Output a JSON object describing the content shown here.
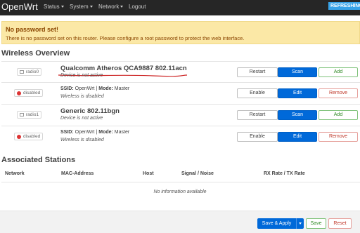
{
  "navbar": {
    "brand": "OpenWrt",
    "menu": [
      {
        "label": "Status",
        "dropdown": true
      },
      {
        "label": "System",
        "dropdown": true
      },
      {
        "label": "Network",
        "dropdown": true
      },
      {
        "label": "Logout",
        "dropdown": false
      }
    ],
    "refresh_badge": "REFRESHING"
  },
  "alert": {
    "title": "No password set!",
    "text": "There is no password set on this router. Please configure a root password to protect the web interface."
  },
  "wireless": {
    "title": "Wireless Overview",
    "rows": [
      {
        "badge": "radio0",
        "title": "Qualcomm Atheros QCA9887 802.11acn",
        "subtitle": "Device is not active",
        "buttons": [
          "Restart",
          "Scan",
          "Add"
        ]
      },
      {
        "badge": "disabled",
        "ssid_label": "SSID:",
        "ssid_value": "OpenWrt",
        "mode_label": "Mode:",
        "mode_value": "Master",
        "subtitle": "Wireless is disabled",
        "buttons": [
          "Enable",
          "Edit",
          "Remove"
        ]
      },
      {
        "badge": "radio1",
        "title": "Generic 802.11bgn",
        "subtitle": "Device is not active",
        "buttons": [
          "Restart",
          "Scan",
          "Add"
        ]
      },
      {
        "badge": "disabled",
        "ssid_label": "SSID:",
        "ssid_value": "OpenWrt",
        "mode_label": "Mode:",
        "mode_value": "Master",
        "subtitle": "Wireless is disabled",
        "buttons": [
          "Enable",
          "Edit",
          "Remove"
        ]
      }
    ]
  },
  "stations": {
    "title": "Associated Stations",
    "columns": [
      "Network",
      "MAC-Address",
      "Host",
      "Signal / Noise",
      "RX Rate / TX Rate"
    ],
    "empty_text": "No information available"
  },
  "footer": {
    "save_apply": "Save & Apply",
    "save": "Save",
    "reset": "Reset"
  },
  "colors": {
    "navbar_bg": "#262626",
    "refresh_badge": "#38a3e8",
    "alert_bg": "#fbe8a6",
    "primary": "#0069d9",
    "positive": "#2e8a24",
    "negative": "#c0392b",
    "annotation_underline": "#cc2222"
  },
  "icons": {
    "device": "wireless-device-icon",
    "disabled": "disabled-status-icon",
    "dropdown": "caret-down-icon"
  }
}
